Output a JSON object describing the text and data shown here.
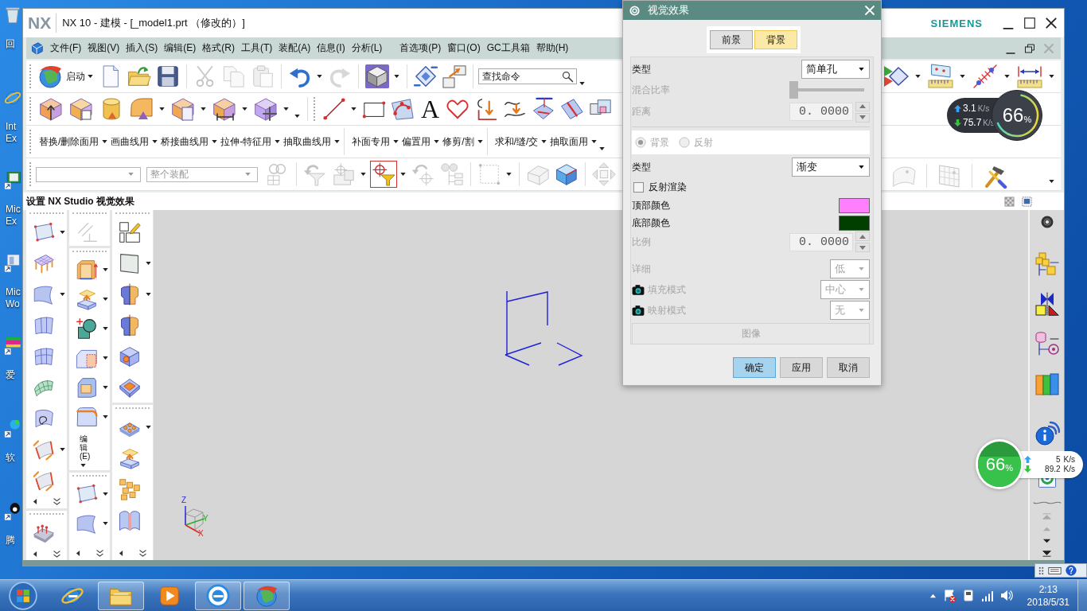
{
  "desktop": {
    "shortcuts": [
      {
        "lines": [
          "回"
        ]
      },
      {
        "lines": [
          "Int",
          "Ex"
        ]
      },
      {
        "lines": [
          "Mic",
          "Ex"
        ]
      },
      {
        "lines": [
          "Mic",
          "Wo"
        ]
      },
      {
        "lines": [
          "爱"
        ]
      },
      {
        "lines": [
          "软"
        ]
      },
      {
        "lines": [
          "腾"
        ]
      }
    ]
  },
  "window": {
    "logo": "NX",
    "title": "NX 10 - 建模 - [_model1.prt （修改的）]",
    "brand": "SIEMENS"
  },
  "menu_bar": {
    "items": [
      "文件(F)",
      "视图(V)",
      "插入(S)",
      "编辑(E)",
      "格式(R)",
      "工具(T)",
      "装配(A)",
      "信息(I)",
      "分析(L)",
      "首选项(P)",
      "窗口(O)",
      "GC工具箱",
      "帮助(H)"
    ]
  },
  "toolbar_1": {
    "start_label": "启动",
    "tools": [
      {
        "disabled": false
      },
      {
        "disabled": false
      },
      {
        "disabled": false
      },
      {
        "disabled": true
      },
      {
        "disabled": true
      },
      {
        "disabled": true
      },
      {
        "disabled": false
      },
      {
        "disabled": true
      },
      {
        "disabled": false
      },
      {
        "disabled": false
      },
      {
        "disabled": false
      }
    ],
    "search": {
      "placeholder": "查找命令"
    }
  },
  "toolbar_2": {
    "text_tool": "A"
  },
  "toolbar_3": {
    "groups": [
      [
        "替换/删除面用",
        "画曲线用",
        "桥接曲线用",
        "拉伸-特征用",
        "抽取曲线用"
      ],
      [
        "补面专用",
        "偏置用",
        "修剪/割"
      ],
      [
        "求和/缝/交",
        "抽取面用"
      ]
    ]
  },
  "toolbar_4": {
    "scope": {
      "value": "整个装配",
      "disabled": true
    },
    "tools": [
      {
        "disabled": true,
        "on": false
      },
      {
        "disabled": true,
        "on": false
      },
      {
        "disabled": true,
        "on": false
      },
      {
        "disabled": false,
        "on": true
      },
      {
        "disabled": true,
        "on": false
      },
      {
        "disabled": true,
        "on": false
      },
      {
        "disabled": true,
        "on": false
      },
      {
        "disabled": true,
        "on": false
      },
      {
        "disabled": false,
        "on": false
      },
      {
        "disabled": true,
        "on": false
      },
      {
        "disabled": true,
        "on": false
      },
      {
        "disabled": true,
        "on": false
      },
      {
        "disabled": false,
        "on": false
      }
    ]
  },
  "panel_header": {
    "title": "设置 NX Studio 视觉效果"
  },
  "palette": {
    "vertical_label": "编辑(E)",
    "columns": [
      [
        {
          "disabled": false
        },
        {
          "disabled": false
        },
        {
          "disabled": false
        },
        {
          "disabled": false
        },
        {
          "disabled": false
        },
        {
          "disabled": false
        },
        {
          "disabled": false
        },
        {
          "disabled": false
        },
        {
          "disabled": false
        },
        {
          "disabled": false
        }
      ],
      [
        {
          "disabled": true
        },
        {
          "disabled": false
        },
        {
          "disabled": false
        },
        {
          "disabled": false
        },
        {
          "disabled": false
        },
        {
          "disabled": false
        },
        {
          "disabled": false
        },
        {
          "disabled": false
        },
        {
          "disabled": false
        }
      ],
      [
        {
          "disabled": false
        },
        {
          "disabled": false
        },
        {
          "disabled": false
        },
        {
          "disabled": false
        },
        {
          "disabled": false
        },
        {
          "disabled": false
        },
        {
          "disabled": false
        },
        {
          "disabled": false
        },
        {
          "disabled": false
        },
        {
          "disabled": false
        }
      ]
    ]
  },
  "triad": {
    "labels": [
      "Z",
      "Y",
      "X"
    ]
  },
  "dialog": {
    "title": "视觉效果",
    "tabs": [
      {
        "label": "前景",
        "selected": false
      },
      {
        "label": "背景",
        "selected": true
      }
    ],
    "rows": [
      {
        "kind": "dropdown",
        "label": "类型",
        "value": "简单孔",
        "disabled": false
      },
      {
        "kind": "slider",
        "label": "混合比率",
        "level": 0,
        "disabled": true
      },
      {
        "kind": "spinner",
        "label": "距离",
        "value": "0. 0000",
        "disabled": true
      },
      {
        "kind": "radio",
        "options": [
          {
            "label": "背景",
            "selected": true
          },
          {
            "label": "反射",
            "selected": false
          }
        ],
        "disabled": true
      },
      {
        "kind": "dropdown",
        "label": "类型",
        "value": "渐变",
        "disabled": false
      },
      {
        "kind": "checkbox",
        "label": "反射渲染",
        "checked": false
      },
      {
        "kind": "color",
        "label": "顶部颜色",
        "color": "#ff80ff"
      },
      {
        "kind": "color",
        "label": "底部颜色",
        "color": "#003f00"
      },
      {
        "kind": "spinner",
        "label": "比例",
        "value": "0. 0000",
        "disabled": true
      },
      {
        "kind": "dropdown",
        "label": "详细",
        "value": "低",
        "disabled": true
      },
      {
        "kind": "dropdown",
        "label": "填充模式",
        "value": "中心",
        "disabled": true,
        "icon": true
      },
      {
        "kind": "dropdown",
        "label": "映射模式",
        "value": "无",
        "disabled": true,
        "icon": true
      },
      {
        "kind": "button",
        "label": "图像",
        "disabled": true
      }
    ],
    "buttons": [
      {
        "label": "确定",
        "default": true
      },
      {
        "label": "应用",
        "default": false
      },
      {
        "label": "取消",
        "default": false
      }
    ]
  },
  "network_widgets": [
    {
      "kind": "ring",
      "up": "3.1",
      "up_unit": "K/s",
      "down": "75.7",
      "down_unit": "K/s",
      "percent": "66",
      "percent_sign": "%"
    },
    {
      "kind": "disc",
      "up": "5",
      "up_unit": "K/s",
      "down": "89.2",
      "down_unit": "K/s",
      "percent": "66",
      "percent_sign": "%",
      "level": 0.66
    }
  ],
  "taskbar": {
    "apps": [
      {
        "running": false
      },
      {
        "running": true
      },
      {
        "running": false
      },
      {
        "running": true
      },
      {
        "running": true
      }
    ],
    "time": "2:13",
    "date": "2018/5/31"
  }
}
